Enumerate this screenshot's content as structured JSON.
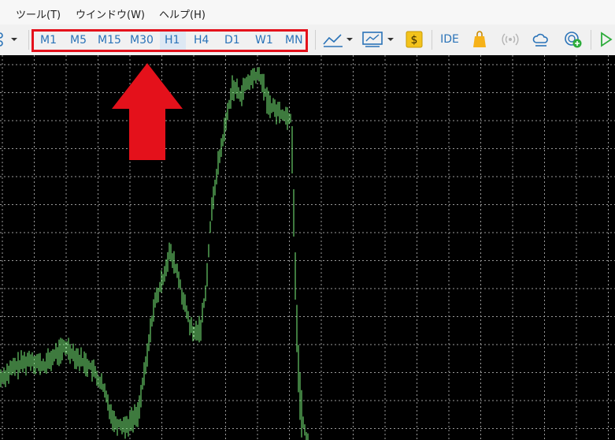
{
  "menu": {
    "tools": "ツール(T)",
    "window": "ウインドウ(W)",
    "help": "ヘルプ(H)"
  },
  "timeframes": [
    "M1",
    "M5",
    "M15",
    "M30",
    "H1",
    "H4",
    "D1",
    "W1",
    "MN"
  ],
  "active_timeframe": "H1",
  "toolbar": {
    "ide_label": "IDE",
    "dollar_label": "$"
  },
  "colors": {
    "highlight_box": "#e4111b",
    "arrow": "#e4111b",
    "timeframe_text": "#2a73b8",
    "candle": "#7cf57c",
    "chart_bg": "#000000"
  },
  "icons": [
    "grid-icon",
    "line-chart-icon",
    "indicator-icon",
    "dollar-icon",
    "market-bag-icon",
    "signal-icon",
    "cloud-icon",
    "add-vps-icon",
    "play-icon"
  ]
}
